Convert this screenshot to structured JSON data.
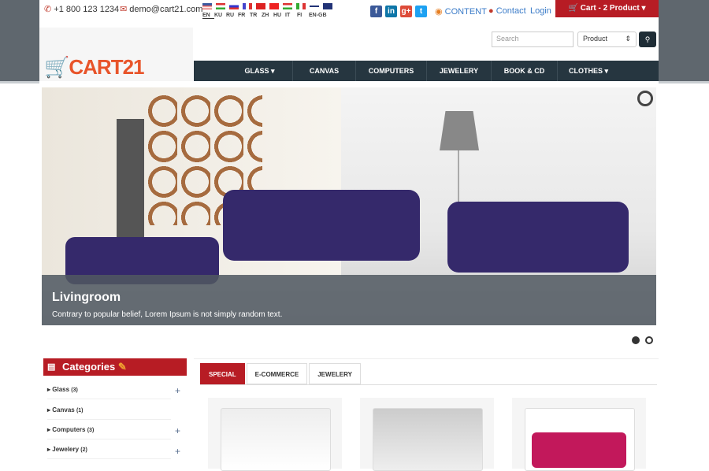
{
  "topbar": {
    "phone": "+1 800 123 1234",
    "email": "demo@cart21.com",
    "languages": [
      "EN",
      "KU",
      "RU",
      "FR",
      "TR",
      "ZH",
      "HU",
      "IT",
      "FI",
      "EN-GB"
    ],
    "active_language": "EN",
    "social": [
      "facebook",
      "linkedin",
      "google-plus",
      "twitter"
    ],
    "content_link": "CONTENT",
    "contact_link": "Contact",
    "login_link": "Login",
    "cart_label": "Cart - 2 Product"
  },
  "search": {
    "placeholder": "Search",
    "category": "Product"
  },
  "logo": {
    "text": "CART21"
  },
  "nav": [
    "GLASS ▾",
    "CANVAS",
    "COMPUTERS ▾",
    "JEWELERY ▾",
    "BOOK & CD",
    "CLOTHES ▾"
  ],
  "slider": {
    "title": "Livingroom",
    "subtitle": "Contrary to popular belief, Lorem Ipsum is not simply random text.",
    "slides": 2,
    "active": 1
  },
  "categories": {
    "title": "Categories",
    "items": [
      {
        "label": "Glass",
        "count": "(3)",
        "expandable": true
      },
      {
        "label": "Canvas",
        "count": "(1)",
        "expandable": false
      },
      {
        "label": "Computers",
        "count": "(3)",
        "expandable": true
      },
      {
        "label": "Jewelery",
        "count": "(2)",
        "expandable": true
      }
    ]
  },
  "tabs": [
    "SPECIAL",
    "E-COMMERCE",
    "JEWELERY"
  ],
  "active_tab": "SPECIAL",
  "colors": {
    "brand": "#b71c24",
    "nav": "#263640"
  }
}
